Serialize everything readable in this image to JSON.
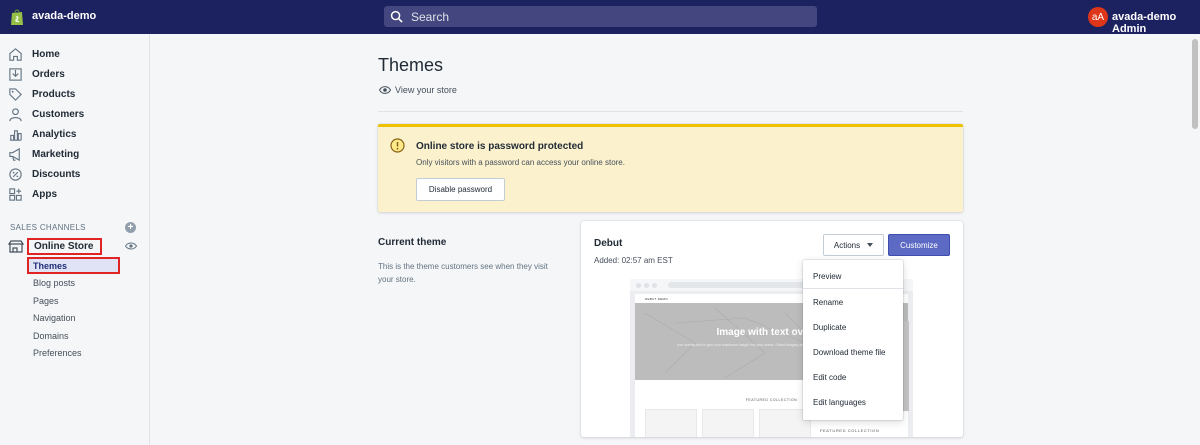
{
  "topbar": {
    "store_name": "avada-demo",
    "search_placeholder": "Search",
    "avatar_initials": "aA",
    "user_name": "avada-demo Admin"
  },
  "sidebar": {
    "items": [
      {
        "label": "Home",
        "icon": "home-icon"
      },
      {
        "label": "Orders",
        "icon": "orders-icon"
      },
      {
        "label": "Products",
        "icon": "tag-icon"
      },
      {
        "label": "Customers",
        "icon": "person-icon"
      },
      {
        "label": "Analytics",
        "icon": "bar-chart-icon"
      },
      {
        "label": "Marketing",
        "icon": "megaphone-icon"
      },
      {
        "label": "Discounts",
        "icon": "discount-icon"
      },
      {
        "label": "Apps",
        "icon": "apps-icon"
      }
    ],
    "channels_heading": "SALES CHANNELS",
    "online_store": "Online Store",
    "sub_items": [
      "Themes",
      "Blog posts",
      "Pages",
      "Navigation",
      "Domains",
      "Preferences"
    ]
  },
  "main": {
    "title": "Themes",
    "view_store": "View your store",
    "banner": {
      "title": "Online store is password protected",
      "text": "Only visitors with a password can access your online store.",
      "button": "Disable password"
    },
    "current_theme": {
      "heading": "Current theme",
      "description": "This is the theme customers see when they visit your store."
    },
    "theme_card": {
      "name": "Debut",
      "added": "Added: 02:57 am EST",
      "actions_label": "Actions",
      "customize_label": "Customize",
      "preview": {
        "brand": "DEBUT DEMO",
        "hero_title": "Image with text overlay",
        "hero_sub": "Use overlay text to give your customers insight into your brand. Select imagery and text that relates to your style and story.",
        "featured": "FEATURED COLLECTION"
      }
    },
    "dropdown": [
      "Preview",
      "Rename",
      "Duplicate",
      "Download theme file",
      "Edit code",
      "Edit languages"
    ],
    "featured_peek": "FEATURED COLLECTION"
  },
  "colors": {
    "topbar": "#1c2260",
    "primary": "#5c6ac4",
    "banner_bg": "#fcf1cd",
    "banner_border": "#eec200",
    "highlight": "#e02424"
  }
}
